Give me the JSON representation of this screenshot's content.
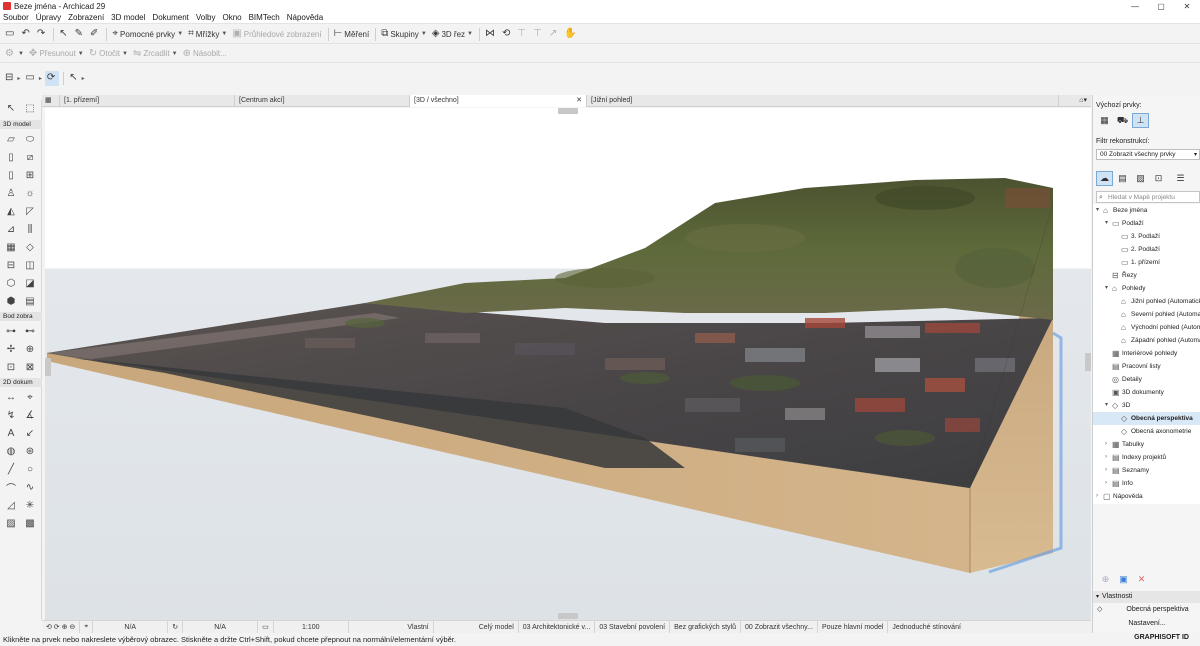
{
  "window": {
    "title": "Beze jména - Archicad 29",
    "min": "—",
    "max": "▢",
    "close": "✕"
  },
  "menu": [
    "Soubor",
    "Úpravy",
    "Zobrazení",
    "3D model",
    "Dokument",
    "Volby",
    "Okno",
    "BIMTech",
    "Nápověda"
  ],
  "toolbar1": {
    "pomocne": "Pomocné prvky",
    "mrizky": "Mřížky",
    "pruhledove": "Průhledové zobrazení",
    "mereni": "Měření",
    "skupiny": "Skupiny",
    "rez3d": "3D řez"
  },
  "toolbar2": {
    "presunout": "Přesunout",
    "otocit": "Otočit",
    "zrcadlit": "Zrcadlit",
    "nasobit": "Násobit..."
  },
  "toolbox": {
    "h1": "3D model",
    "h2": "Bod zobra",
    "h3": "2D dokum"
  },
  "tabs": [
    {
      "label": "[1. přízemí]"
    },
    {
      "label": "[Centrum akcí]"
    },
    {
      "label": "[3D / všechno]"
    },
    {
      "label": "[Jižní pohled]"
    }
  ],
  "statusbar": {
    "na1": "N/A",
    "na2": "N/A",
    "scale": "1:100",
    "vlastni": "Vlastní",
    "cely": "Celý model",
    "arch": "03 Architektonické v...",
    "stav": "03 Stavební povolení",
    "bez": "Bez grafických stylů",
    "zobr": "00 Zobrazit všechny...",
    "pouze": "Pouze hlavní model",
    "jedn": "Jednoduché stínování"
  },
  "hint": "Klikněte na prvek nebo nakreslete výběrový obrazec. Stiskněte a držte Ctrl+Shift, pokud chcete přepnout na normální/elementární výběr.",
  "right_panel": {
    "vychozi": "Výchozí prvky:",
    "filtr": "Filtr rekonstrukcí:",
    "filtr_value": "00 Zobrazit všechny prvky",
    "search_placeholder": "Hledat v Mapě projektu",
    "tree": [
      {
        "label": "Beze jména",
        "lvl": 0,
        "tg": "▾",
        "ic": "⌂"
      },
      {
        "label": "Podlaží",
        "lvl": 1,
        "tg": "▾",
        "ic": "▭"
      },
      {
        "label": "3. Podlaží",
        "lvl": 2,
        "tg": "",
        "ic": "▭"
      },
      {
        "label": "2. Podlaží",
        "lvl": 2,
        "tg": "",
        "ic": "▭"
      },
      {
        "label": "1. přízemí",
        "lvl": 2,
        "tg": "",
        "ic": "▭"
      },
      {
        "label": "Řezy",
        "lvl": 1,
        "tg": "",
        "ic": "⊟"
      },
      {
        "label": "Pohledy",
        "lvl": 1,
        "tg": "▾",
        "ic": "⌂"
      },
      {
        "label": "Jižní pohled (Automatick",
        "lvl": 2,
        "tg": "",
        "ic": "⌂"
      },
      {
        "label": "Severní pohled (Automa",
        "lvl": 2,
        "tg": "",
        "ic": "⌂"
      },
      {
        "label": "Východní pohled (Autom",
        "lvl": 2,
        "tg": "",
        "ic": "⌂"
      },
      {
        "label": "Západní pohled (Automa",
        "lvl": 2,
        "tg": "",
        "ic": "⌂"
      },
      {
        "label": "Interiérové pohledy",
        "lvl": 1,
        "tg": "",
        "ic": "▦"
      },
      {
        "label": "Pracovní listy",
        "lvl": 1,
        "tg": "",
        "ic": "▤"
      },
      {
        "label": "Detaily",
        "lvl": 1,
        "tg": "",
        "ic": "◎"
      },
      {
        "label": "3D dokumenty",
        "lvl": 1,
        "tg": "",
        "ic": "▣"
      },
      {
        "label": "3D",
        "lvl": 1,
        "tg": "▾",
        "ic": "◇"
      },
      {
        "label": "Obecná perspektiva",
        "lvl": 2,
        "tg": "",
        "ic": "◇",
        "sel": true
      },
      {
        "label": "Obecná axonometrie",
        "lvl": 2,
        "tg": "",
        "ic": "◇"
      },
      {
        "label": "Tabulky",
        "lvl": 1,
        "tg": "›",
        "ic": "▦"
      },
      {
        "label": "Indexy projektů",
        "lvl": 1,
        "tg": "›",
        "ic": "▤"
      },
      {
        "label": "Seznamy",
        "lvl": 1,
        "tg": "›",
        "ic": "▤"
      },
      {
        "label": "Info",
        "lvl": 1,
        "tg": "›",
        "ic": "▤"
      },
      {
        "label": "Nápověda",
        "lvl": 0,
        "tg": "›",
        "ic": "▢"
      }
    ],
    "vlastnosti": "Vlastnosti",
    "prop_value": "Obecná perspektiva",
    "nastaveni": "Nastavení...",
    "brand": "GRAPHISOFT ID"
  }
}
